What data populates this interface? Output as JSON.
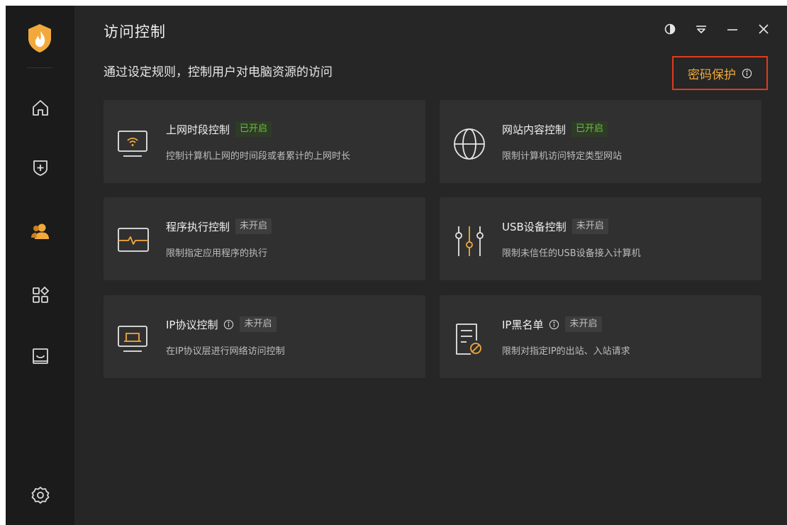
{
  "app": {
    "title": "访问控制",
    "subtitle": "通过设定规则，控制用户对电脑资源的访问"
  },
  "header_action": {
    "label": "密码保护",
    "icon": "info-icon",
    "accent_color": "#f2a93b",
    "highlight_color": "#e03a1e"
  },
  "sidebar": {
    "items": [
      {
        "icon": "home-icon",
        "active": false
      },
      {
        "icon": "shield-plus-icon",
        "active": false
      },
      {
        "icon": "users-icon",
        "active": true
      },
      {
        "icon": "apps-icon",
        "active": false
      },
      {
        "icon": "inbox-icon",
        "active": false
      },
      {
        "icon": "gear-icon",
        "active": false
      }
    ],
    "active_color": "#f2a93b"
  },
  "window_controls": [
    "theme-icon",
    "menu-icon",
    "minimize-icon",
    "close-icon"
  ],
  "cards": [
    {
      "title": "上网时段控制",
      "status": "已开启",
      "status_on": true,
      "info": false,
      "desc": "控制计算机上网的时间段或者累计的上网时长",
      "icon": "monitor-wifi-icon"
    },
    {
      "title": "网站内容控制",
      "status": "已开启",
      "status_on": true,
      "info": false,
      "desc": "限制计算机访问特定类型网站",
      "icon": "globe-icon"
    },
    {
      "title": "程序执行控制",
      "status": "未开启",
      "status_on": false,
      "info": false,
      "desc": "限制指定应用程序的执行",
      "icon": "program-pulse-icon"
    },
    {
      "title": "USB设备控制",
      "status": "未开启",
      "status_on": false,
      "info": false,
      "desc": "限制未信任的USB设备接入计算机",
      "icon": "sliders-icon"
    },
    {
      "title": "IP协议控制",
      "status": "未开启",
      "status_on": false,
      "info": true,
      "desc": "在IP协议层进行网络访问控制",
      "icon": "monitor-ip-icon"
    },
    {
      "title": "IP黑名单",
      "status": "未开启",
      "status_on": false,
      "info": true,
      "desc": "限制对指定IP的出站、入站请求",
      "icon": "document-block-icon"
    }
  ]
}
